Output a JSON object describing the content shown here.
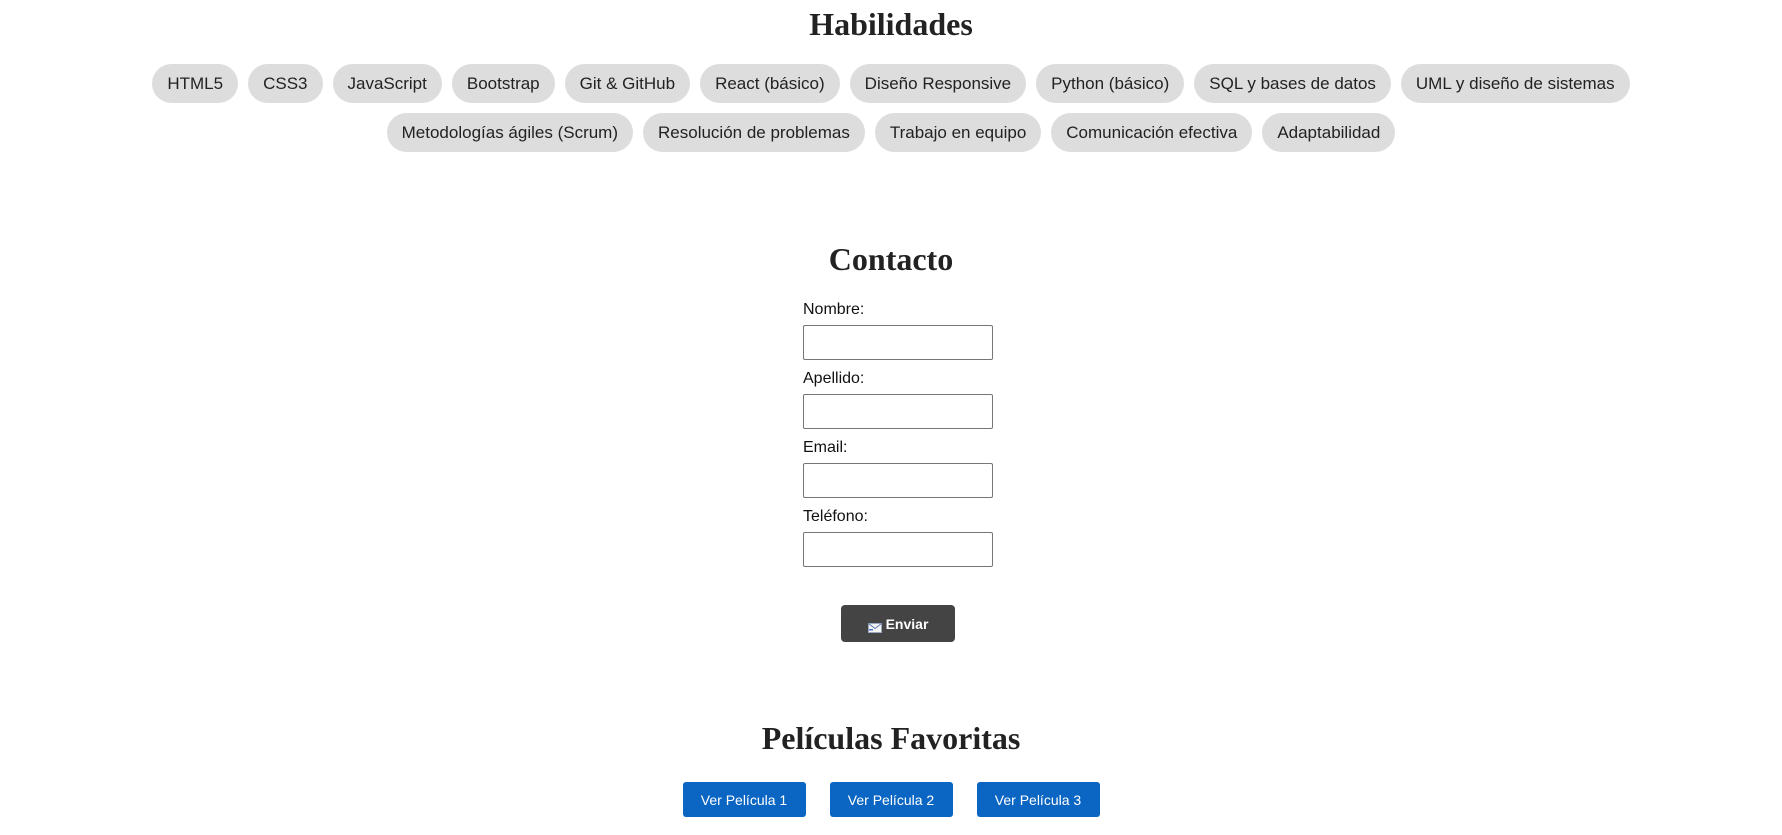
{
  "skills": {
    "title": "Habilidades",
    "items": [
      "HTML5",
      "CSS3",
      "JavaScript",
      "Bootstrap",
      "Git & GitHub",
      "React (básico)",
      "Diseño Responsive",
      "Python (básico)",
      "SQL y bases de datos",
      "UML y diseño de sistemas",
      "Metodologías ágiles (Scrum)",
      "Resolución de problemas",
      "Trabajo en equipo",
      "Comunicación efectiva",
      "Adaptabilidad"
    ]
  },
  "contact": {
    "title": "Contacto",
    "fields": {
      "nombre_label": "Nombre:",
      "nombre_value": "",
      "apellido_label": "Apellido:",
      "apellido_value": "",
      "email_label": "Email:",
      "email_value": "",
      "telefono_label": "Teléfono:",
      "telefono_value": ""
    },
    "submit_label": "Enviar",
    "submit_icon": "envelope-icon"
  },
  "movies": {
    "title": "Películas Favoritas",
    "buttons": [
      "Ver Película 1",
      "Ver Película 2",
      "Ver Película 3"
    ]
  },
  "colors": {
    "tag_background": "#dddddd",
    "submit_background": "#444444",
    "movie_button_background": "#0a66c2"
  }
}
